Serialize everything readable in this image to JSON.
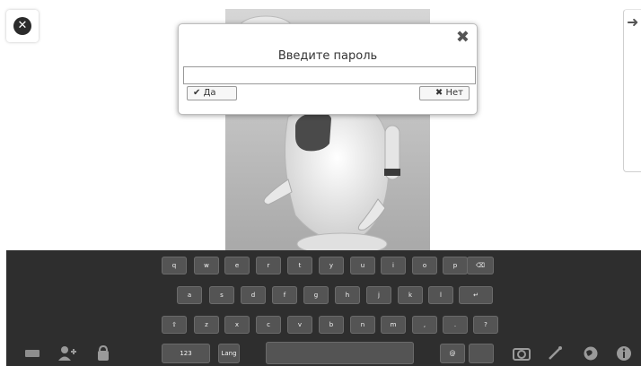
{
  "dialog": {
    "title": "Введите пароль",
    "password_value": "",
    "yes_label": "Да",
    "no_label": "Нет",
    "close_icon": "close-icon"
  },
  "keyboard": {
    "row1": [
      "q",
      "w",
      "e",
      "r",
      "t",
      "y",
      "u",
      "i",
      "o",
      "p",
      "⌫"
    ],
    "row2": [
      "a",
      "s",
      "d",
      "f",
      "g",
      "h",
      "j",
      "k",
      "l",
      "↵"
    ],
    "row3": [
      "⇧",
      "z",
      "x",
      "c",
      "v",
      "b",
      "n",
      "m",
      ",",
      ".",
      "?"
    ],
    "row4": [
      "123",
      "Lang",
      "",
      "@",
      ""
    ]
  },
  "icons": {
    "top_left": "close-circle-icon",
    "right_panel": "arrow-left-icon",
    "bottom_left": [
      "minus-icon",
      "add-user-icon",
      "lock-robot-icon"
    ],
    "bottom_right": [
      "camera-icon",
      "magic-wand-icon",
      "globe-icon",
      "info-icon"
    ]
  },
  "colors": {
    "keyboard_bg": "#2e2e2e",
    "key_bg": "#545454",
    "icon_gray": "#9a9a9a"
  }
}
